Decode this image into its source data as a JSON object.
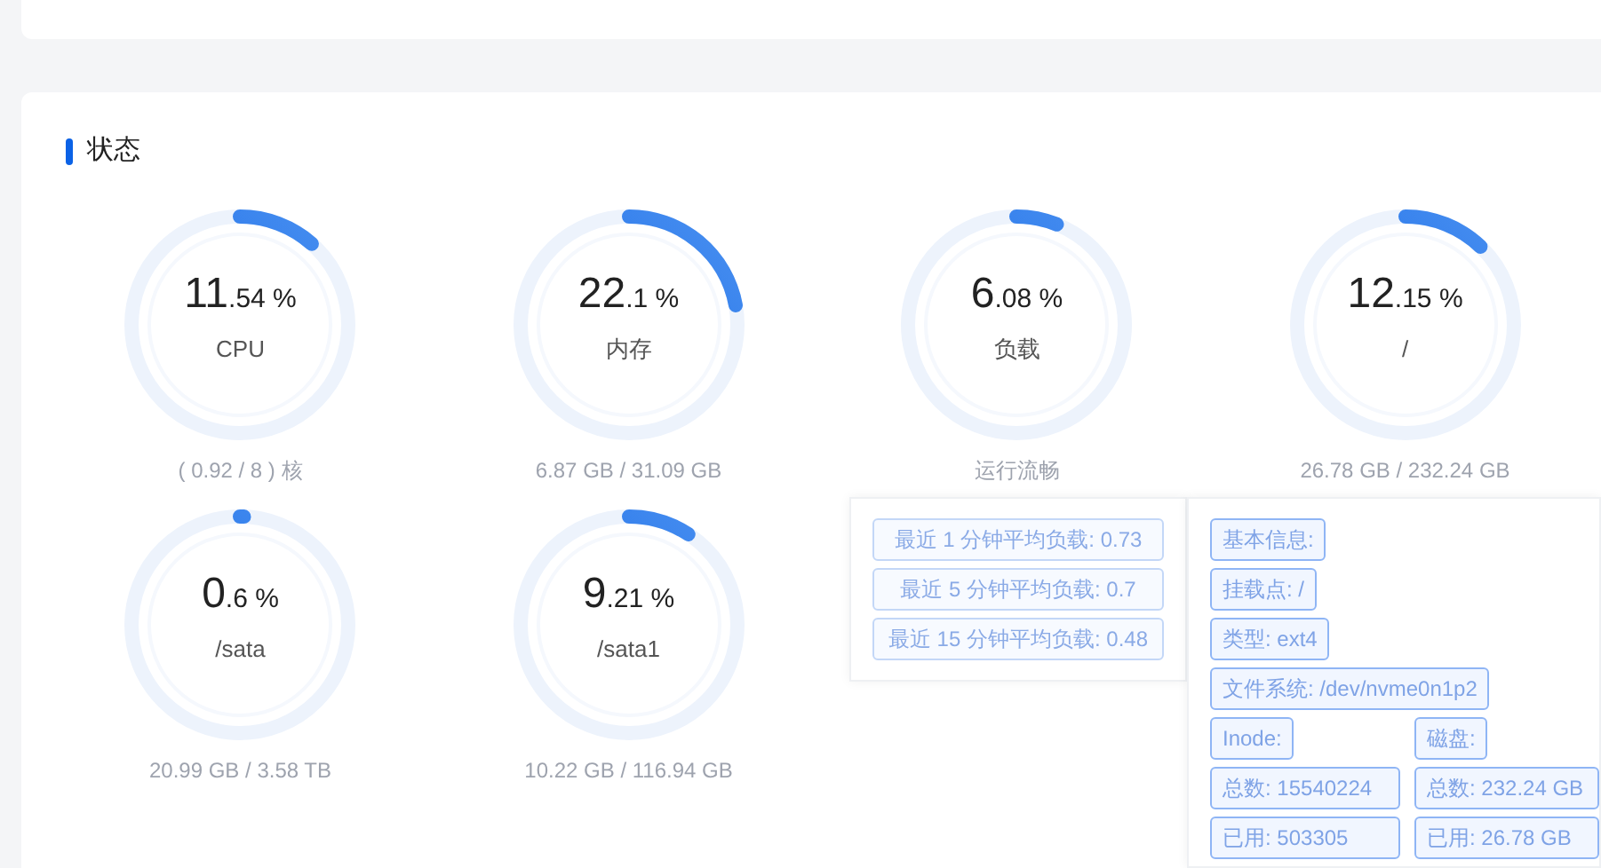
{
  "section": {
    "title": "状态"
  },
  "gauges": [
    {
      "whole": "11",
      "fraction": ".54 %",
      "label": "CPU",
      "footer": "( 0.92 / 8 ) 核",
      "level": 0.1154
    },
    {
      "whole": "22",
      "fraction": ".1 %",
      "label": "内存",
      "footer": "6.87 GB / 31.09 GB",
      "level": 0.221
    },
    {
      "whole": "6",
      "fraction": ".08 %",
      "label": "负载",
      "footer": "运行流畅",
      "level": 0.0608
    },
    {
      "whole": "12",
      "fraction": ".15 %",
      "label": "/",
      "footer": "26.78 GB / 232.24 GB",
      "level": 0.1215
    },
    {
      "whole": "0",
      "fraction": ".6 %",
      "label": "/sata",
      "footer": "20.99 GB / 3.58 TB",
      "level": 0.006
    },
    {
      "whole": "9",
      "fraction": ".21 %",
      "label": "/sata1",
      "footer": "10.22 GB / 116.94 GB",
      "level": 0.0921
    }
  ],
  "load_tooltip": {
    "items": [
      "最近 1 分钟平均负载: 0.73",
      "最近 5 分钟平均负载: 0.7",
      "最近 15 分钟平均负载: 0.48"
    ]
  },
  "disk_tooltip": {
    "rows": [
      [
        "基本信息:"
      ],
      [
        "挂载点: /"
      ],
      [
        "类型: ext4"
      ],
      [
        "文件系统: /dev/nvme0n1p2"
      ],
      [
        "Inode:",
        "磁盘:"
      ],
      [
        "总数: 15540224",
        "总数: 232.24 GB"
      ],
      [
        "已用: 503305",
        "已用: 26.78 GB"
      ]
    ]
  }
}
